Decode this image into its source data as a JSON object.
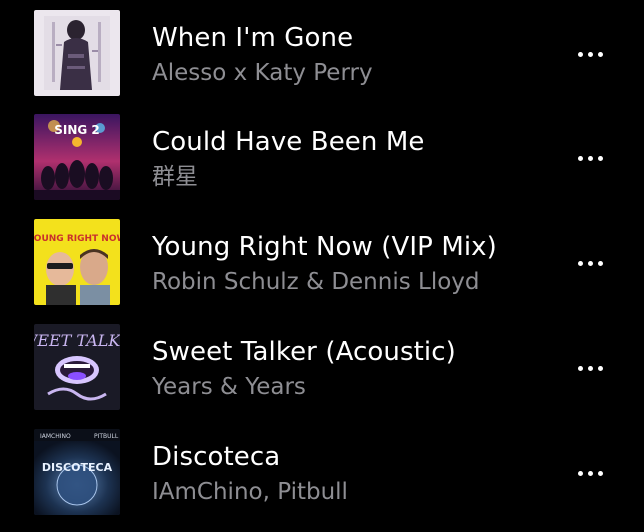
{
  "tracks": [
    {
      "title": "When I'm Gone",
      "artist": "Alesso x Katy Perry",
      "artwork_icon": "album-art-when-im-gone"
    },
    {
      "title": "Could Have Been Me",
      "artist": "群星",
      "artwork_icon": "album-art-sing-2",
      "artwork_text": "SING 2"
    },
    {
      "title": "Young Right Now (VIP Mix)",
      "artist": "Robin Schulz & Dennis Lloyd",
      "artwork_icon": "album-art-young-right-now",
      "artwork_text": "YOUNG RIGHT NOW"
    },
    {
      "title": "Sweet Talker (Acoustic)",
      "artist": "Years & Years",
      "artwork_icon": "album-art-sweet-talker",
      "artwork_text": "SWEET TALKER"
    },
    {
      "title": "Discoteca",
      "artist": "IAmChino, Pitbull",
      "artwork_icon": "album-art-discoteca",
      "artwork_text": "DISCOTECA"
    }
  ],
  "more_icon": "more-horizontal-icon",
  "colors": {
    "background": "#000000",
    "title": "#ffffff",
    "subtitle": "#8e8e93"
  }
}
